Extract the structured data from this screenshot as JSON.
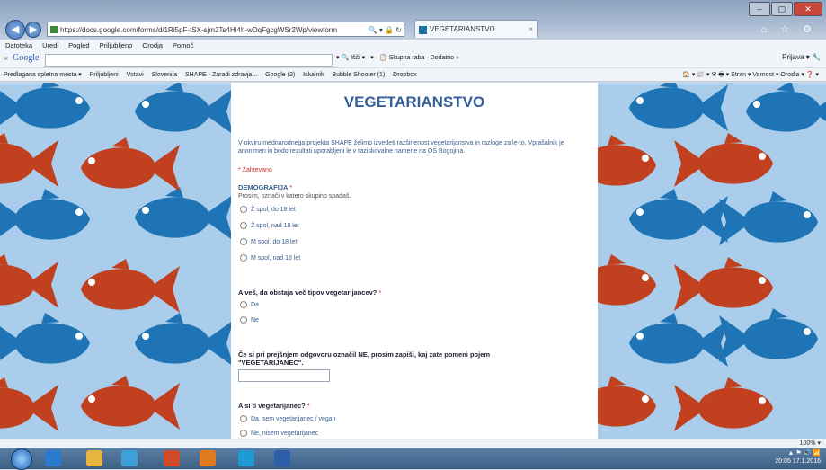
{
  "browser": {
    "address": "https://docs.google.com/forms/d/1Ri5pF-tSX-sjm2Ts4Hi4h-wDqFgcgWSr2Wp/viewform",
    "address_tools": "🔍 ▾ 🔒 ↻",
    "tab_title": "VEGETARIANSTVO",
    "tab_close": "×",
    "back_arrow": "◀",
    "forward_arrow": "▶",
    "win_controls": [
      "–",
      "▢",
      "✕"
    ],
    "right_icons": "⌂ ☆ ⚙",
    "menu": [
      "Datoteka",
      "Uredi",
      "Pogled",
      "Priljubljeno",
      "Orodja",
      "Pomoč"
    ],
    "google_close": "×",
    "google_logo": "Google",
    "google_tools": "▾ 🔍 Išči ▾ · ▾ · 📋 Skupna raba · Dodatno »",
    "google_right": "Prijava ▾ 🔧",
    "favorites": [
      "Predlagana spletna mesta ▾",
      "Priljubljeni",
      "Vstavi",
      "Slovenija",
      "SHAPE - Zaradi zdravja...",
      "Google (2)",
      "Iskalnik",
      "Bubble Shooter (1)",
      "Dropbox"
    ],
    "commandbar": "🏠 ▾ 📰 ▾ ✉ 🖶 ▾ Stran ▾ Varnost ▾ Orodja ▾ ❓ ▾"
  },
  "form": {
    "title": "VEGETARIANSTVO",
    "intro": "V okviru mednarodnega projekta SHAPE želimo izvedeti razširjenost vegetarijanstva in razloge za le-to. Vprašalnik je anonimen in bodo rezultati uporabljeni le v raziskovalne namene na OŠ Bogojina.",
    "required_note": "* Zahtevano",
    "q1": {
      "title": "DEMOGRAFIJA",
      "star": "*",
      "help": "Prosim, označi v katero skupino spadaš.",
      "options": [
        "Ž spol, do 18 let",
        "Ž spol, nad 18 let",
        "M spol, do 18 let",
        "M spol, nad 18 let"
      ]
    },
    "q2": {
      "title": "A veš, da obstaja več tipov vegetarijancev?",
      "star": "*",
      "options": [
        "Da",
        "Ne"
      ]
    },
    "q3": {
      "title": "Če si pri prejšnjem odgovoru označil NE, prosim zapiši, kaj zate pomeni pojem \"VEGETARIJANEC\"."
    },
    "q4": {
      "title": "A si ti vegetarijanec?",
      "star": "*",
      "options": [
        "Da, sem vegetarijanec / vegan",
        "Ne, nisem vegetarijanec"
      ]
    }
  },
  "status": {
    "zoom": "100% ▾"
  },
  "taskbar": {
    "tray_icons": "▲ ⚑ 🔊 📶",
    "time": "20:05",
    "date": "17.1.2016"
  },
  "colors": {
    "fish_blue": "#1f74b5",
    "fish_red": "#c0401f",
    "bg_blue": "#a9cdea",
    "form_title": "#35609a"
  }
}
